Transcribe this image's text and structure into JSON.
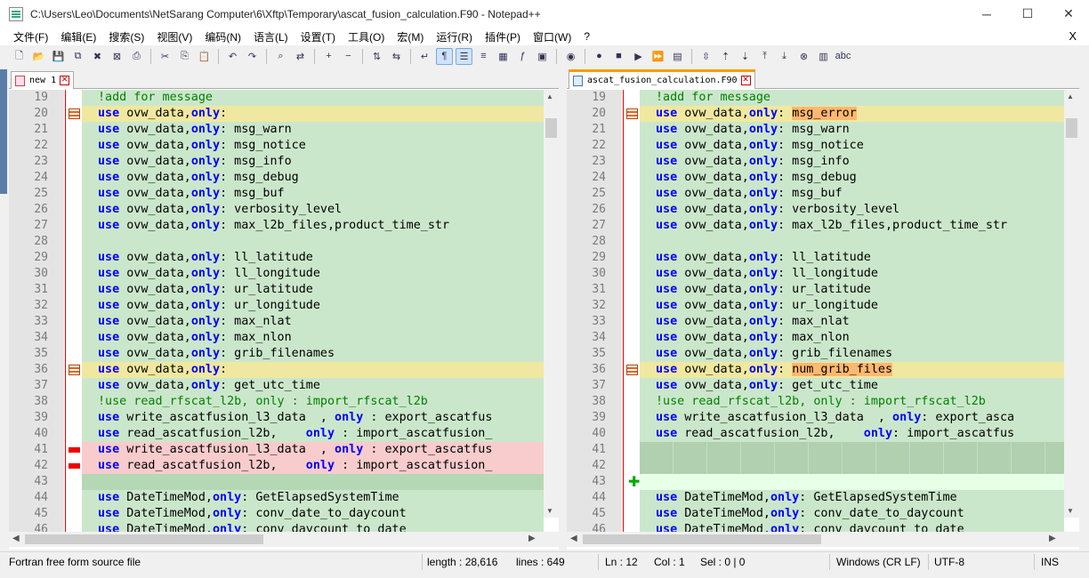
{
  "window": {
    "title": "C:\\Users\\Leo\\Documents\\NetSarang Computer\\6\\Xftp\\Temporary\\ascat_fusion_calculation.F90 - Notepad++"
  },
  "menu": [
    "文件(F)",
    "编辑(E)",
    "搜索(S)",
    "视图(V)",
    "编码(N)",
    "语言(L)",
    "设置(T)",
    "工具(O)",
    "宏(M)",
    "运行(R)",
    "插件(P)",
    "窗口(W)",
    "?"
  ],
  "menu_close": "X",
  "toolbar_icons": [
    "new-file-icon",
    "open-file-icon",
    "save-icon",
    "save-all-icon",
    "close-icon",
    "close-all-icon",
    "print-icon",
    "cut-icon",
    "copy-icon",
    "paste-icon",
    "undo-icon",
    "redo-icon",
    "find-icon",
    "replace-icon",
    "zoom-in-icon",
    "zoom-out-icon",
    "sync-vertical-icon",
    "sync-horizontal-icon",
    "word-wrap-icon",
    "show-all-chars-icon",
    "indent-guide-icon",
    "language-icon",
    "doc-map-icon",
    "function-list-icon",
    "folder-workspace-icon",
    "monitor-icon",
    "record-macro-icon",
    "stop-macro-icon",
    "play-macro-icon",
    "run-macro-multiple-icon",
    "save-macro-icon",
    "compare-icon",
    "prev-diff-icon",
    "next-diff-icon",
    "first-diff-icon",
    "last-diff-icon",
    "clear-compare-icon",
    "navigation-bar-icon",
    "spellcheck-icon"
  ],
  "left_pane": {
    "tab_label": "new 1",
    "lines": [
      {
        "n": "19",
        "state": "normal",
        "parts": [
          [
            "cm",
            "!add for message"
          ]
        ]
      },
      {
        "n": "20",
        "state": "changed",
        "marker": "change",
        "parts": [
          [
            "kw",
            "use"
          ],
          [
            "",
            "ovw_data,"
          ],
          [
            "kw",
            "only"
          ],
          [
            "",
            ":"
          ]
        ]
      },
      {
        "n": "21",
        "state": "normal",
        "parts": [
          [
            "kw",
            "use"
          ],
          [
            "",
            "ovw_data,"
          ],
          [
            "kw",
            "only"
          ],
          [
            "",
            ": msg_warn"
          ]
        ]
      },
      {
        "n": "22",
        "state": "normal",
        "parts": [
          [
            "kw",
            "use"
          ],
          [
            "",
            "ovw_data,"
          ],
          [
            "kw",
            "only"
          ],
          [
            "",
            ": msg_notice"
          ]
        ]
      },
      {
        "n": "23",
        "state": "normal",
        "parts": [
          [
            "kw",
            "use"
          ],
          [
            "",
            "ovw_data,"
          ],
          [
            "kw",
            "only"
          ],
          [
            "",
            ": msg_info"
          ]
        ]
      },
      {
        "n": "24",
        "state": "normal",
        "parts": [
          [
            "kw",
            "use"
          ],
          [
            "",
            "ovw_data,"
          ],
          [
            "kw",
            "only"
          ],
          [
            "",
            ": msg_debug"
          ]
        ]
      },
      {
        "n": "25",
        "state": "normal",
        "parts": [
          [
            "kw",
            "use"
          ],
          [
            "",
            "ovw_data,"
          ],
          [
            "kw",
            "only"
          ],
          [
            "",
            ": msg_buf"
          ]
        ]
      },
      {
        "n": "26",
        "state": "normal",
        "parts": [
          [
            "kw",
            "use"
          ],
          [
            "",
            "ovw_data,"
          ],
          [
            "kw",
            "only"
          ],
          [
            "",
            ": verbosity_level"
          ]
        ]
      },
      {
        "n": "27",
        "state": "normal",
        "parts": [
          [
            "kw",
            "use"
          ],
          [
            "",
            "ovw_data,"
          ],
          [
            "kw",
            "only"
          ],
          [
            "",
            ": max_l2b_files,product_time_str"
          ]
        ]
      },
      {
        "n": "28",
        "state": "normal",
        "parts": []
      },
      {
        "n": "29",
        "state": "normal",
        "parts": [
          [
            "kw",
            "use"
          ],
          [
            "",
            "ovw_data,"
          ],
          [
            "kw",
            "only"
          ],
          [
            "",
            ": ll_latitude"
          ]
        ]
      },
      {
        "n": "30",
        "state": "normal",
        "parts": [
          [
            "kw",
            "use"
          ],
          [
            "",
            "ovw_data,"
          ],
          [
            "kw",
            "only"
          ],
          [
            "",
            ": ll_longitude"
          ]
        ]
      },
      {
        "n": "31",
        "state": "normal",
        "parts": [
          [
            "kw",
            "use"
          ],
          [
            "",
            "ovw_data,"
          ],
          [
            "kw",
            "only"
          ],
          [
            "",
            ": ur_latitude"
          ]
        ]
      },
      {
        "n": "32",
        "state": "normal",
        "parts": [
          [
            "kw",
            "use"
          ],
          [
            "",
            "ovw_data,"
          ],
          [
            "kw",
            "only"
          ],
          [
            "",
            ": ur_longitude"
          ]
        ]
      },
      {
        "n": "33",
        "state": "normal",
        "parts": [
          [
            "kw",
            "use"
          ],
          [
            "",
            "ovw_data,"
          ],
          [
            "kw",
            "only"
          ],
          [
            "",
            ": max_nlat"
          ]
        ]
      },
      {
        "n": "34",
        "state": "normal",
        "parts": [
          [
            "kw",
            "use"
          ],
          [
            "",
            "ovw_data,"
          ],
          [
            "kw",
            "only"
          ],
          [
            "",
            ": max_nlon"
          ]
        ]
      },
      {
        "n": "35",
        "state": "normal",
        "parts": [
          [
            "kw",
            "use"
          ],
          [
            "",
            "ovw_data,"
          ],
          [
            "kw",
            "only"
          ],
          [
            "",
            ": grib_filenames"
          ]
        ]
      },
      {
        "n": "36",
        "state": "changed",
        "marker": "change",
        "parts": [
          [
            "kw",
            "use"
          ],
          [
            "",
            "ovw_data,"
          ],
          [
            "kw",
            "only"
          ],
          [
            "",
            ":"
          ]
        ]
      },
      {
        "n": "37",
        "state": "normal",
        "parts": [
          [
            "kw",
            "use"
          ],
          [
            "",
            "ovw_data,"
          ],
          [
            "kw",
            "only"
          ],
          [
            "",
            ": get_utc_time"
          ]
        ]
      },
      {
        "n": "38",
        "state": "normal",
        "parts": [
          [
            "cm",
            "!use read_rfscat_l2b, only : import_rfscat_l2b"
          ]
        ]
      },
      {
        "n": "39",
        "state": "normal",
        "parts": [
          [
            "kw",
            "use"
          ],
          [
            "",
            "write_ascatfusion_l3_data  , "
          ],
          [
            "kw",
            "only"
          ],
          [
            "",
            " : export_ascatfus"
          ]
        ]
      },
      {
        "n": "40",
        "state": "normal",
        "parts": [
          [
            "kw",
            "use"
          ],
          [
            "",
            "read_ascatfusion_l2b,    "
          ],
          [
            "kw",
            "only"
          ],
          [
            "",
            " : import_ascatfusion_"
          ]
        ]
      },
      {
        "n": "41",
        "state": "deleted",
        "marker": "del",
        "parts": [
          [
            "kw",
            "use"
          ],
          [
            "",
            "write_ascatfusion_l3_data  , "
          ],
          [
            "kw",
            "only"
          ],
          [
            "",
            " : export_ascatfus"
          ]
        ]
      },
      {
        "n": "42",
        "state": "deleted",
        "marker": "del",
        "parts": [
          [
            "kw",
            "use"
          ],
          [
            "",
            "read_ascatfusion_l2b,    "
          ],
          [
            "kw",
            "only"
          ],
          [
            "",
            " : import_ascatfusion_"
          ]
        ]
      },
      {
        "n": "43",
        "state": "blank",
        "parts": []
      },
      {
        "n": "44",
        "state": "normal",
        "parts": [
          [
            "kw",
            "use"
          ],
          [
            "",
            "DateTimeMod,"
          ],
          [
            "kw",
            "only"
          ],
          [
            "",
            ": GetElapsedSystemTime"
          ]
        ]
      },
      {
        "n": "45",
        "state": "normal",
        "parts": [
          [
            "kw",
            "use"
          ],
          [
            "",
            "DateTimeMod,"
          ],
          [
            "kw",
            "only"
          ],
          [
            "",
            ": conv_date_to_daycount"
          ]
        ]
      },
      {
        "n": "46",
        "state": "normal",
        "parts": [
          [
            "kw",
            "use"
          ],
          [
            "",
            "DateTimeMod,"
          ],
          [
            "kw",
            "only"
          ],
          [
            "",
            ": conv_daycount_to_date"
          ]
        ]
      }
    ]
  },
  "right_pane": {
    "tab_label": "ascat_fusion_calculation.F90",
    "lines": [
      {
        "n": "19",
        "state": "normal",
        "parts": [
          [
            "cm",
            "!add for message"
          ]
        ]
      },
      {
        "n": "20",
        "state": "changed",
        "marker": "change",
        "parts": [
          [
            "kw",
            "use"
          ],
          [
            "",
            "ovw_data,"
          ],
          [
            "kw",
            "only"
          ],
          [
            "",
            ": "
          ],
          [
            "hl",
            "msg_error"
          ]
        ]
      },
      {
        "n": "21",
        "state": "normal",
        "parts": [
          [
            "kw",
            "use"
          ],
          [
            "",
            "ovw_data,"
          ],
          [
            "kw",
            "only"
          ],
          [
            "",
            ": msg_warn"
          ]
        ]
      },
      {
        "n": "22",
        "state": "normal",
        "parts": [
          [
            "kw",
            "use"
          ],
          [
            "",
            "ovw_data,"
          ],
          [
            "kw",
            "only"
          ],
          [
            "",
            ": msg_notice"
          ]
        ]
      },
      {
        "n": "23",
        "state": "normal",
        "parts": [
          [
            "kw",
            "use"
          ],
          [
            "",
            "ovw_data,"
          ],
          [
            "kw",
            "only"
          ],
          [
            "",
            ": msg_info"
          ]
        ]
      },
      {
        "n": "24",
        "state": "normal",
        "parts": [
          [
            "kw",
            "use"
          ],
          [
            "",
            "ovw_data,"
          ],
          [
            "kw",
            "only"
          ],
          [
            "",
            ": msg_debug"
          ]
        ]
      },
      {
        "n": "25",
        "state": "normal",
        "parts": [
          [
            "kw",
            "use"
          ],
          [
            "",
            "ovw_data,"
          ],
          [
            "kw",
            "only"
          ],
          [
            "",
            ": msg_buf"
          ]
        ]
      },
      {
        "n": "26",
        "state": "normal",
        "parts": [
          [
            "kw",
            "use"
          ],
          [
            "",
            "ovw_data,"
          ],
          [
            "kw",
            "only"
          ],
          [
            "",
            ": verbosity_level"
          ]
        ]
      },
      {
        "n": "27",
        "state": "normal",
        "parts": [
          [
            "kw",
            "use"
          ],
          [
            "",
            "ovw_data,"
          ],
          [
            "kw",
            "only"
          ],
          [
            "",
            ": max_l2b_files,product_time_str"
          ]
        ]
      },
      {
        "n": "28",
        "state": "normal",
        "parts": []
      },
      {
        "n": "29",
        "state": "normal",
        "parts": [
          [
            "kw",
            "use"
          ],
          [
            "",
            "ovw_data,"
          ],
          [
            "kw",
            "only"
          ],
          [
            "",
            ": ll_latitude"
          ]
        ]
      },
      {
        "n": "30",
        "state": "normal",
        "parts": [
          [
            "kw",
            "use"
          ],
          [
            "",
            "ovw_data,"
          ],
          [
            "kw",
            "only"
          ],
          [
            "",
            ": ll_longitude"
          ]
        ]
      },
      {
        "n": "31",
        "state": "normal",
        "parts": [
          [
            "kw",
            "use"
          ],
          [
            "",
            "ovw_data,"
          ],
          [
            "kw",
            "only"
          ],
          [
            "",
            ": ur_latitude"
          ]
        ]
      },
      {
        "n": "32",
        "state": "normal",
        "parts": [
          [
            "kw",
            "use"
          ],
          [
            "",
            "ovw_data,"
          ],
          [
            "kw",
            "only"
          ],
          [
            "",
            ": ur_longitude"
          ]
        ]
      },
      {
        "n": "33",
        "state": "normal",
        "parts": [
          [
            "kw",
            "use"
          ],
          [
            "",
            "ovw_data,"
          ],
          [
            "kw",
            "only"
          ],
          [
            "",
            ": max_nlat"
          ]
        ]
      },
      {
        "n": "34",
        "state": "normal",
        "parts": [
          [
            "kw",
            "use"
          ],
          [
            "",
            "ovw_data,"
          ],
          [
            "kw",
            "only"
          ],
          [
            "",
            ": max_nlon"
          ]
        ]
      },
      {
        "n": "35",
        "state": "normal",
        "parts": [
          [
            "kw",
            "use"
          ],
          [
            "",
            "ovw_data,"
          ],
          [
            "kw",
            "only"
          ],
          [
            "",
            ": grib_filenames"
          ]
        ]
      },
      {
        "n": "36",
        "state": "changed",
        "marker": "change",
        "parts": [
          [
            "kw",
            "use"
          ],
          [
            "",
            "ovw_data,"
          ],
          [
            "kw",
            "only"
          ],
          [
            "",
            ": "
          ],
          [
            "hl",
            "num_grib_files"
          ]
        ]
      },
      {
        "n": "37",
        "state": "normal",
        "parts": [
          [
            "kw",
            "use"
          ],
          [
            "",
            "ovw_data,"
          ],
          [
            "kw",
            "only"
          ],
          [
            "",
            ": get_utc_time"
          ]
        ]
      },
      {
        "n": "38",
        "state": "normal",
        "parts": [
          [
            "cm",
            "!use read_rfscat_l2b, only : import_rfscat_l2b"
          ]
        ]
      },
      {
        "n": "39",
        "state": "normal",
        "parts": [
          [
            "kw",
            "use"
          ],
          [
            "",
            "write_ascatfusion_l3_data  , "
          ],
          [
            "kw",
            "only"
          ],
          [
            "",
            ": export_asca"
          ]
        ]
      },
      {
        "n": "40",
        "state": "normal",
        "parts": [
          [
            "kw",
            "use"
          ],
          [
            "",
            "read_ascatfusion_l2b,    "
          ],
          [
            "kw",
            "only"
          ],
          [
            "",
            ": import_ascatfus"
          ]
        ]
      },
      {
        "n": "41",
        "state": "hatched",
        "parts": []
      },
      {
        "n": "42",
        "state": "hatched",
        "parts": []
      },
      {
        "n": "43",
        "state": "added",
        "marker": "add",
        "parts": []
      },
      {
        "n": "44",
        "state": "normal",
        "parts": [
          [
            "kw",
            "use"
          ],
          [
            "",
            "DateTimeMod,"
          ],
          [
            "kw",
            "only"
          ],
          [
            "",
            ": GetElapsedSystemTime"
          ]
        ]
      },
      {
        "n": "45",
        "state": "normal",
        "parts": [
          [
            "kw",
            "use"
          ],
          [
            "",
            "DateTimeMod,"
          ],
          [
            "kw",
            "only"
          ],
          [
            "",
            ": conv_date_to_daycount"
          ]
        ]
      },
      {
        "n": "46",
        "state": "normal",
        "parts": [
          [
            "kw",
            "use"
          ],
          [
            "",
            "DateTimeMod,"
          ],
          [
            "kw",
            "only"
          ],
          [
            "",
            ": conv_daycount_to_date"
          ]
        ]
      }
    ]
  },
  "status": {
    "file_type": "Fortran free form source file",
    "length": "length : 28,616",
    "lines": "lines : 649",
    "ln": "Ln : 12",
    "col": "Col : 1",
    "sel": "Sel : 0 | 0",
    "eol": "Windows (CR LF)",
    "encoding": "UTF-8",
    "mode": "INS"
  },
  "colors": {
    "normal": "#cbe7cb",
    "changed": "#f0e8a0",
    "deleted": "#f8cccc",
    "blank": "#b4d8b4",
    "added": "#e8ffe8",
    "hatched": "#b0d0b0",
    "highlight": "#ffb870"
  }
}
